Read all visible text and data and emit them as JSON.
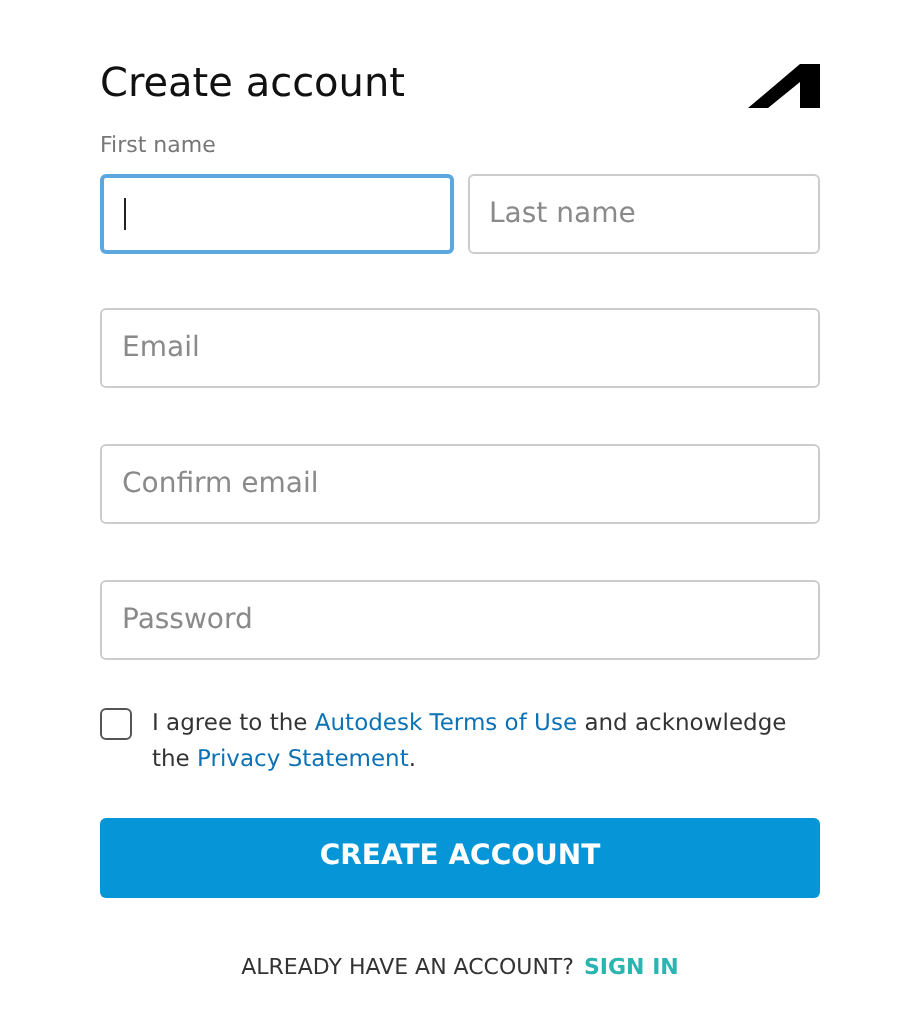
{
  "title": "Create account",
  "name_fields": [
    {
      "label": "First name",
      "focused": true
    },
    {
      "placeholder": "Last name",
      "focused": false
    }
  ],
  "fields": [
    {
      "placeholder": "Email",
      "focused": false
    },
    {
      "placeholder": "Confirm email",
      "focused": false
    },
    {
      "placeholder": "Password",
      "focused": false
    }
  ],
  "agreement": {
    "checked": false,
    "parts": [
      {
        "kind": "text",
        "text": "I agree to the "
      },
      {
        "kind": "link",
        "text": "Autodesk Terms of Use"
      },
      {
        "kind": "text",
        "text": " and acknowledge the "
      },
      {
        "kind": "link",
        "text": "Privacy Statement"
      },
      {
        "kind": "text",
        "text": "."
      }
    ]
  },
  "submit": "CREATE ACCOUNT",
  "footer": {
    "text": "ALREADY HAVE AN ACCOUNT?",
    "link": "SIGN IN"
  }
}
